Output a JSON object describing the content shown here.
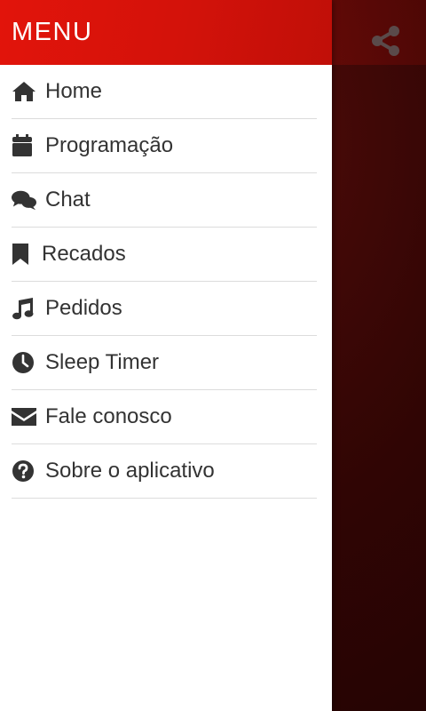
{
  "drawer": {
    "title": "MENU",
    "items": [
      {
        "label": "Home",
        "icon": "home-icon"
      },
      {
        "label": "Programação",
        "icon": "calendar-icon"
      },
      {
        "label": "Chat",
        "icon": "chat-bubbles-icon"
      },
      {
        "label": "Recados",
        "icon": "bookmark-icon"
      },
      {
        "label": "Pedidos",
        "icon": "music-note-icon"
      },
      {
        "label": "Sleep Timer",
        "icon": "clock-icon"
      },
      {
        "label": "Fale conosco",
        "icon": "envelope-icon"
      },
      {
        "label": "Sobre o aplicativo",
        "icon": "question-circle-icon"
      }
    ]
  },
  "app": {
    "share_icon": "share-icon"
  },
  "colors": {
    "header_red": "#e2140b",
    "icon_gray": "#333333",
    "divider": "#dcdcdc",
    "background_dark": "#2a0504"
  }
}
